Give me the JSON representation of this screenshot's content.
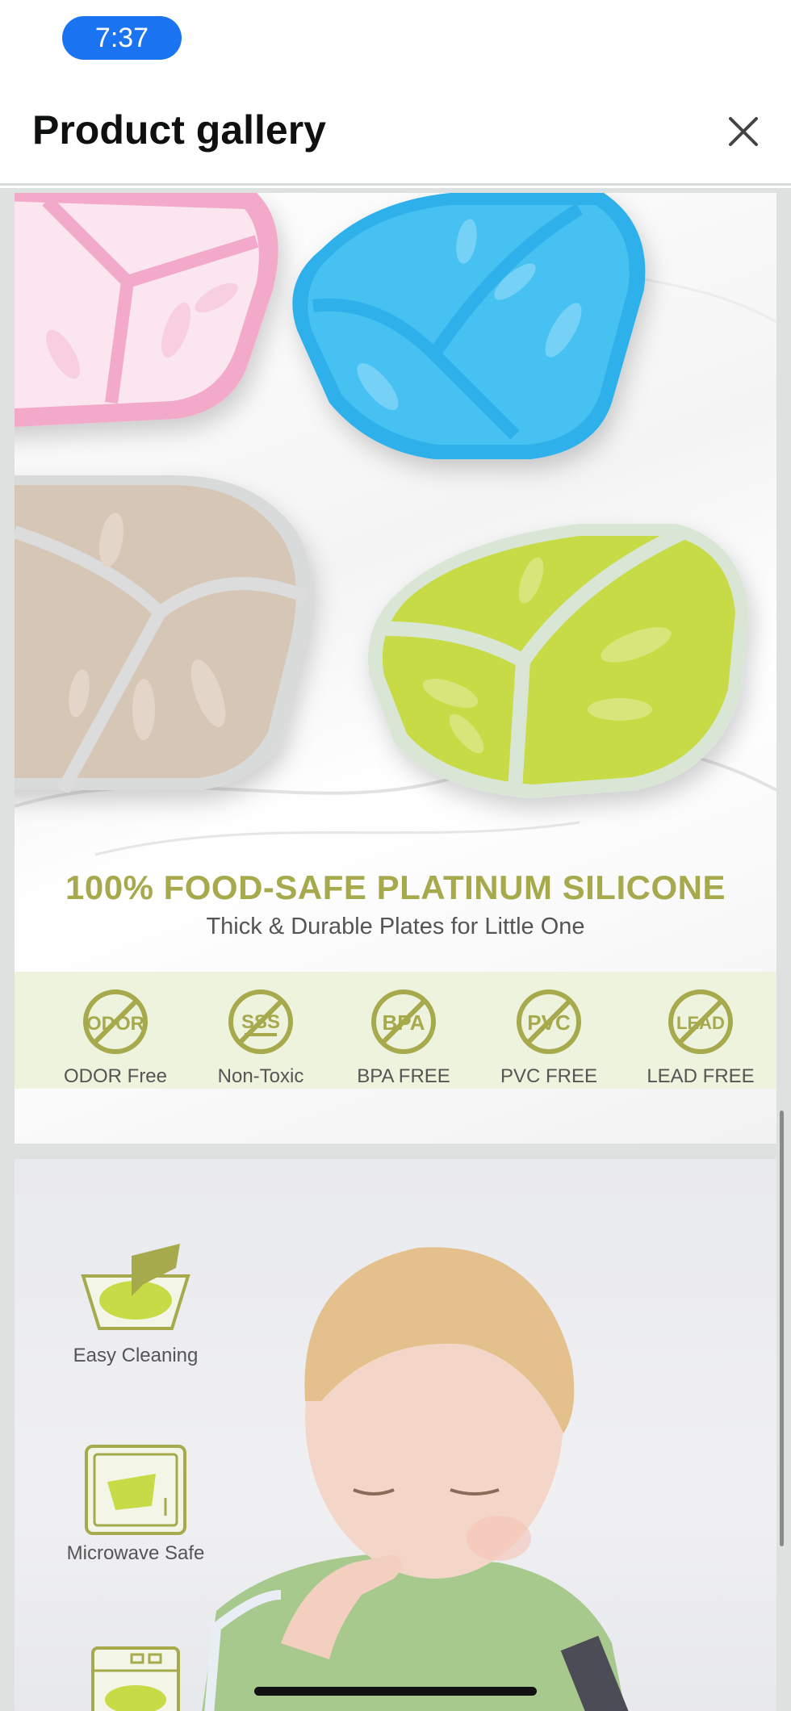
{
  "status_bar": {
    "time": "7:37"
  },
  "header": {
    "title": "Product gallery",
    "close_icon": "close-icon"
  },
  "gallery": {
    "image1": {
      "headline": "100% FOOD-SAFE PLATINUM SILICONE",
      "subline": "Thick & Durable Plates for Little One",
      "plate_colors": [
        "#f5a6c8",
        "#34b4ec",
        "#d8c8b8",
        "#c5da4a"
      ],
      "badges": [
        {
          "icon": "odor",
          "icon_text": "ODOR",
          "label": "ODOR Free"
        },
        {
          "icon": "non-toxic",
          "icon_text": "SSS",
          "label": "Non-Toxic"
        },
        {
          "icon": "bpa",
          "icon_text": "BPA",
          "label": "BPA FREE"
        },
        {
          "icon": "pvc",
          "icon_text": "PVC",
          "label": "PVC FREE"
        },
        {
          "icon": "lead",
          "icon_text": "LEAD",
          "label": "LEAD FREE"
        }
      ]
    },
    "image2": {
      "features": [
        {
          "icon": "easy-cleaning-icon",
          "label": "Easy Cleaning"
        },
        {
          "icon": "microwave-icon",
          "label": "Microwave Safe"
        },
        {
          "icon": "dishwasher-icon",
          "label": ""
        }
      ]
    }
  },
  "colors": {
    "accent": "#1a73f0",
    "badge": "#a6a94c",
    "badge_band": "#eef3dd"
  }
}
